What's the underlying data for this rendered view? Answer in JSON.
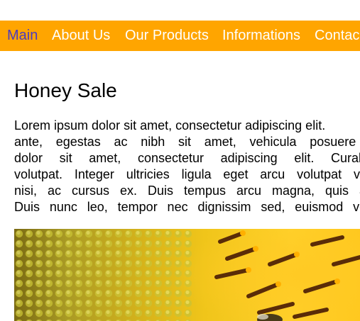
{
  "nav": {
    "items": [
      {
        "label": "Main"
      },
      {
        "label": "About Us"
      },
      {
        "label": "Our Products"
      },
      {
        "label": "Informations"
      },
      {
        "label": "Contac"
      }
    ]
  },
  "page": {
    "title": "Honey Sale",
    "paragraph_lines": [
      "Lorem ipsum dolor sit amet, consectetur adipiscing elit.",
      "ante, egestas ac nibh sit amet, vehicula posuere qu",
      "dolor sit amet, consectetur adipiscing elit. Curabitur",
      "volutpat. Integer ultricies ligula eget arcu volutpat vehic",
      "nisi, ac cursus ex. Duis tempus arcu magna, quis auct",
      "Duis nunc leo, tempor nec dignissim sed, euismod vel r"
    ]
  },
  "colors": {
    "nav_background": "#ffa500",
    "nav_text": "#ffffff",
    "nav_active_text": "#4b3bbf"
  },
  "hero_image": {
    "icon": "sunflower-bee-photo"
  }
}
